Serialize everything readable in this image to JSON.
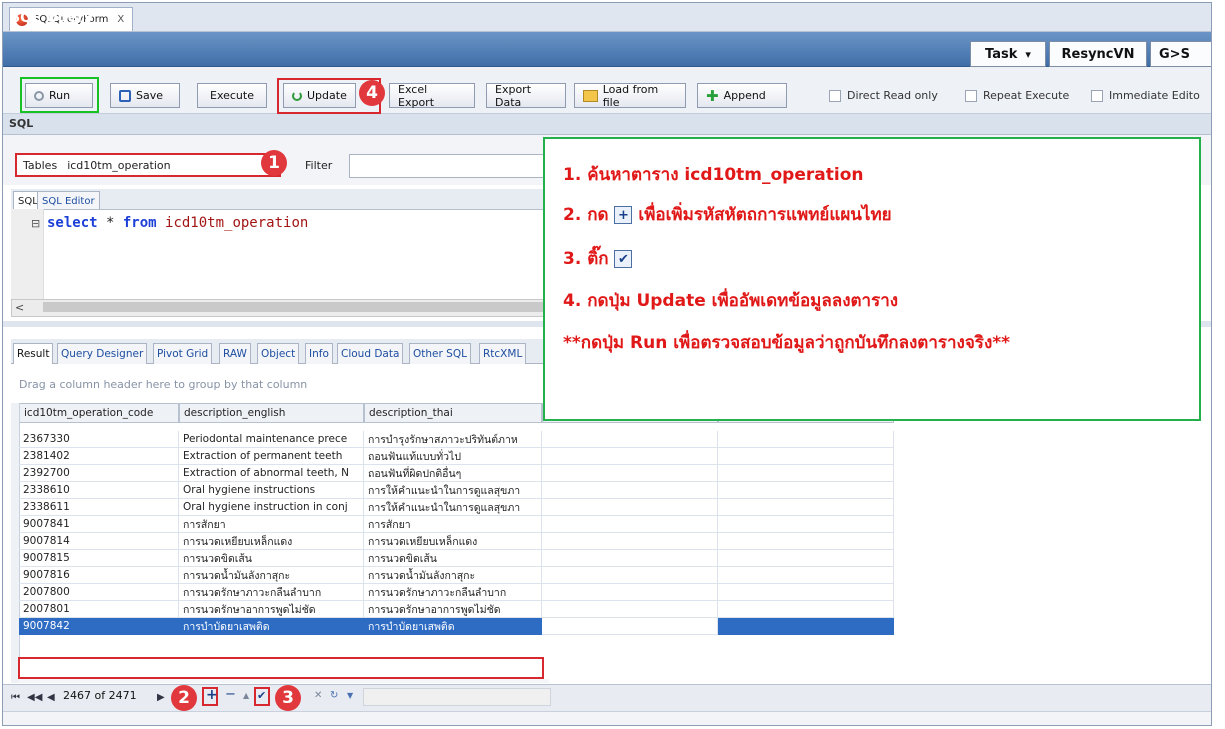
{
  "tab": {
    "title": "SQLQueryForm",
    "close": "X"
  },
  "header": {
    "title": "SQL Query",
    "task_label": "Task",
    "task_arrow": "▾",
    "resync_label": "ResyncVN",
    "g_label": "G>S"
  },
  "toolbar": {
    "run": "Run",
    "save": "Save",
    "execute": "Execute",
    "update": "Update",
    "excel_export": "Excel Export",
    "export_data": "Export Data",
    "load_from_file": "Load from file",
    "append": "Append",
    "direct_read_only": "Direct Read only",
    "repeat_execute": "Repeat Execute",
    "immediate_edit": "Immediate Edito"
  },
  "sql_section": {
    "header": "SQL",
    "tables_label": "Tables",
    "tables_value": "icd10tm_operation",
    "filter_label": "Filter"
  },
  "editor": {
    "tabs": [
      "SQL",
      "SQL Editor"
    ],
    "fold": "⊟",
    "kw1": "select",
    "star": " * ",
    "kw2": "from",
    "table": " icd10tm_operation",
    "scroll_left": "<"
  },
  "result_tabs": [
    "Result",
    "Query Designer",
    "Pivot Grid",
    "RAW",
    "Object",
    "Info",
    "Cloud Data",
    "Other SQL",
    "RtcXML"
  ],
  "grid": {
    "group_hint": "Drag a column header here to group by that column",
    "columns": [
      "icd10tm_operation_code",
      "description_english",
      "description_thai"
    ],
    "rows": [
      [
        "2367330",
        "Periodontal maintenance prece",
        "การบำรุงรักษาสภาวะปริทันต์ภาห"
      ],
      [
        "2381402",
        "Extraction of permanent teeth",
        "ถอนฟันแท้แบบทั่วไป"
      ],
      [
        "2392700",
        "Extraction of abnormal teeth, N",
        "ถอนฟันที่ผิดปกติอื่นๆ"
      ],
      [
        "2338610",
        "Oral hygiene instructions",
        "การให้คำแนะนำในการดูแลสุขภา"
      ],
      [
        "2338611",
        "Oral hygiene instruction in conj",
        "การให้คำแนะนำในการดูแลสุขภา"
      ],
      [
        "9007841",
        "การสักยา",
        "การสักยา"
      ],
      [
        "9007814",
        "การนวดเหยียบเหล็กแดง",
        "การนวดเหยียบเหล็กแดง"
      ],
      [
        "9007815",
        "การนวดขิดเส้น",
        "การนวดขิดเส้น"
      ],
      [
        "9007816",
        "การนวดน้ำมันลังกาสุกะ",
        "การนวดน้ำมันลังกาสุกะ"
      ],
      [
        "2007800",
        "การนวดรักษาภาวะกลืนลำบาก",
        "การนวดรักษาภาวะกลืนลำบาก"
      ],
      [
        "2007801",
        "การนวดรักษาอาการพูดไม่ชัด",
        "การนวดรักษาอาการพูดไม่ชัด"
      ],
      [
        "9007842",
        "การบำบัดยาเสพติด",
        "การบำบัดยาเสพติด"
      ]
    ]
  },
  "navigator": {
    "first": "⏮",
    "prev_page": "◀◀",
    "prev": "◀",
    "record": "2467 of 2471",
    "next": "▶",
    "add": "+",
    "remove": "−",
    "up": "▲",
    "confirm": "✔",
    "cancel": "✕",
    "refresh": "↻",
    "filter": "▼"
  },
  "badges": [
    "1",
    "2",
    "3",
    "4"
  ],
  "instructions": {
    "line1": "1. ค้นหาตาราง icd10tm_operation",
    "line2_a": "2. กด",
    "line2_b": "เพื่อเพิ่มรหัสหัตถการแพทย์แผนไทย",
    "line3": "3. ติ๊ก",
    "line4": "4. กดปุ่ม Update เพื่ออัพเดทข้อมูลลงตาราง",
    "line5": "**กดปุ่ม Run เพื่อตรวจสอบข้อมูลว่าถูกบันทึกลงตารางจริง**",
    "plus_glyph": "+",
    "check_glyph": "✔"
  },
  "colors": {
    "annotation_red": "#e01818",
    "panel_border": "#24b14c",
    "run_outline": "#19c224",
    "selection": "#2e6cc4",
    "title_bar": "#3f6ea8"
  }
}
